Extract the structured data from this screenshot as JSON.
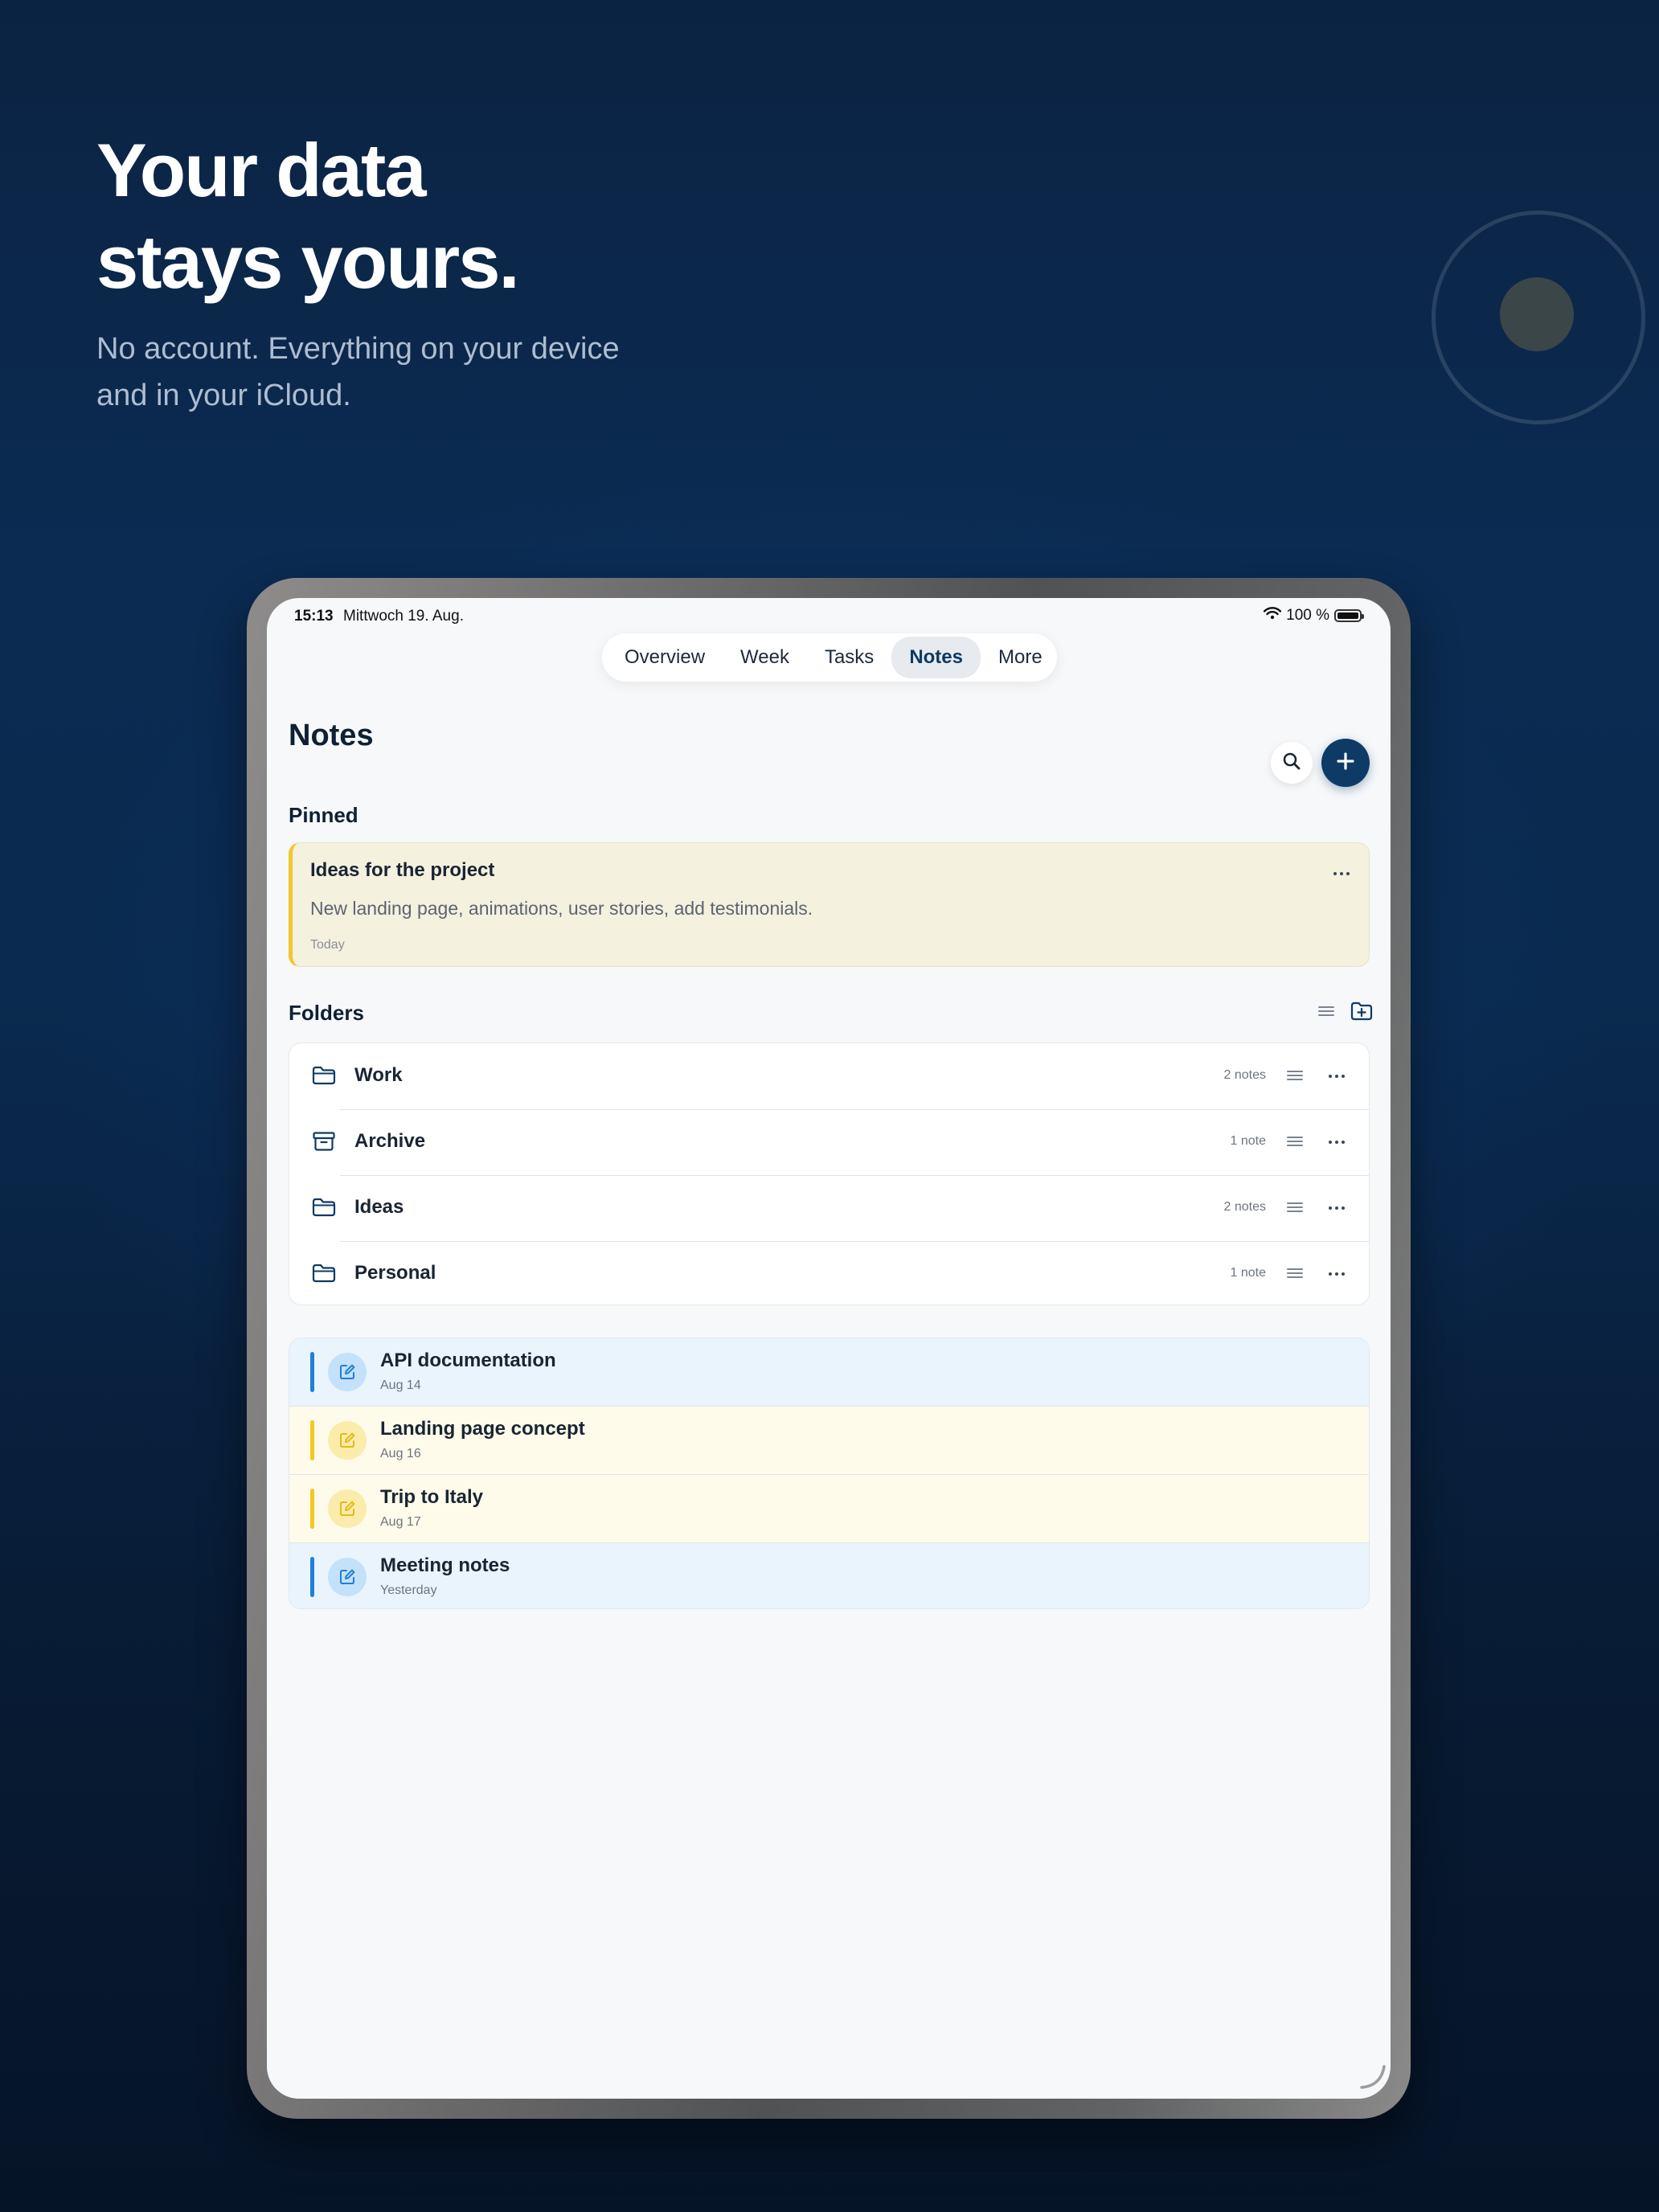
{
  "hero": {
    "title_line1": "Your data",
    "title_line2": "stays yours.",
    "subtitle_line1": "No account. Everything on your device",
    "subtitle_line2": "and in your iCloud."
  },
  "status_bar": {
    "time": "15:13",
    "date": "Mittwoch 19. Aug.",
    "battery": "100 %"
  },
  "tabs": [
    {
      "label": "Overview",
      "active": false
    },
    {
      "label": "Week",
      "active": false
    },
    {
      "label": "Tasks",
      "active": false
    },
    {
      "label": "Notes",
      "active": true
    },
    {
      "label": "More",
      "active": false
    }
  ],
  "page": {
    "title": "Notes"
  },
  "pinned": {
    "section_label": "Pinned",
    "note": {
      "title": "Ideas for the project",
      "body": "New landing page, animations, user stories, add testimonials.",
      "date": "Today",
      "accent": "#f4c531"
    }
  },
  "folders": {
    "section_label": "Folders",
    "items": [
      {
        "name": "Work",
        "count": "2 notes",
        "icon": "folder-icon"
      },
      {
        "name": "Archive",
        "count": "1 note",
        "icon": "archive-box-icon"
      },
      {
        "name": "Ideas",
        "count": "2 notes",
        "icon": "folder-icon"
      },
      {
        "name": "Personal",
        "count": "1 note",
        "icon": "folder-icon"
      }
    ]
  },
  "notes": [
    {
      "title": "API documentation",
      "date": "Aug 14",
      "color": "blue"
    },
    {
      "title": "Landing page concept",
      "date": "Aug 16",
      "color": "yellow"
    },
    {
      "title": "Trip to Italy",
      "date": "Aug 17",
      "color": "yellow"
    },
    {
      "title": "Meeting notes",
      "date": "Yesterday",
      "color": "blue"
    }
  ],
  "colors": {
    "brand": "#0d3b66",
    "note_blue_accent": "#1f7fdc",
    "note_yellow_accent": "#f3c81f",
    "background_navy": "#0b2342"
  }
}
